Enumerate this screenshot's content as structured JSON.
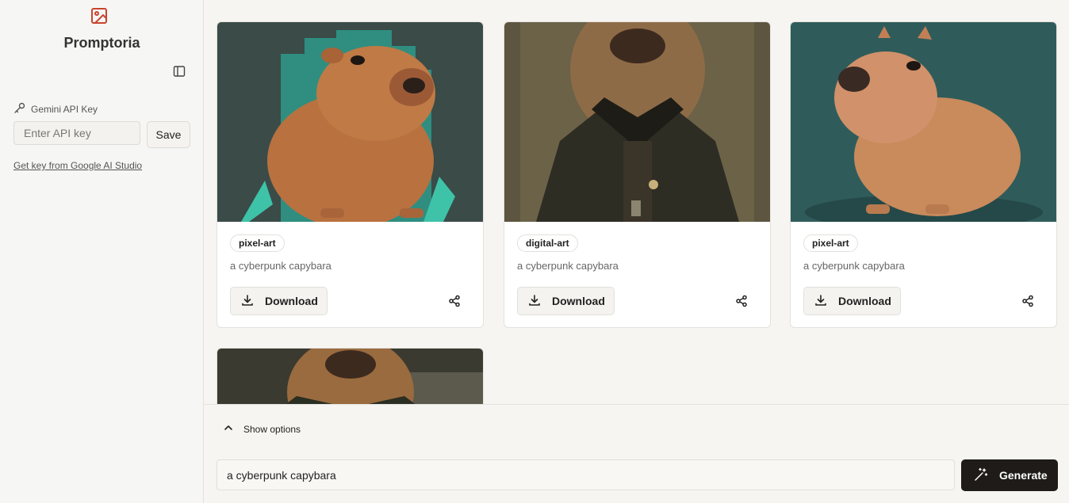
{
  "sidebar": {
    "brand": "Promptoria",
    "api_key_label": "Gemini API Key",
    "api_key_placeholder": "Enter API key",
    "save_label": "Save",
    "get_key_link": "Get key from Google AI Studio"
  },
  "gallery": {
    "cards": [
      {
        "tag": "pixel-art",
        "prompt": "a cyberpunk capybara",
        "download_label": "Download"
      },
      {
        "tag": "digital-art",
        "prompt": "a cyberpunk capybara",
        "download_label": "Download"
      },
      {
        "tag": "pixel-art",
        "prompt": "a cyberpunk capybara",
        "download_label": "Download"
      }
    ]
  },
  "bottom": {
    "show_options_label": "Show options",
    "prompt_value": "a cyberpunk capybara",
    "generate_label": "Generate"
  },
  "colors": {
    "accent": "#c8452c",
    "generate_bg": "#1e1b18"
  }
}
